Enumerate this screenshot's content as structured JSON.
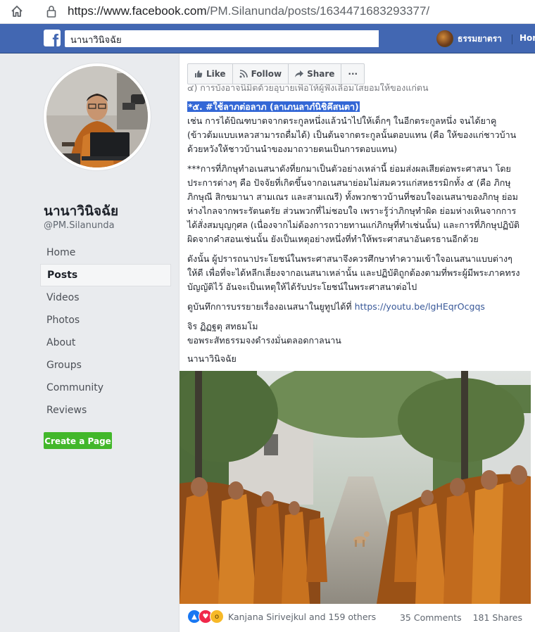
{
  "browser": {
    "url_host": "https://www.facebook.com",
    "url_path": "/PM.Silanunda/posts/1634471683293377/"
  },
  "topbar": {
    "search_value": "นานาวินิจฉัย",
    "user_name": "ธรรมยาตรา",
    "home_label": "Hon",
    "colors": {
      "bar": "#4267b2"
    }
  },
  "page": {
    "name": "นานาวินิจฉัย",
    "handle": "@PM.Silanunda",
    "nav": [
      "Home",
      "Posts",
      "Videos",
      "Photos",
      "About",
      "Groups",
      "Community",
      "Reviews"
    ],
    "active_nav": "Posts",
    "create_page_label": "Create a Page"
  },
  "actions": {
    "like": "Like",
    "follow": "Follow",
    "share": "Share",
    "more": "···"
  },
  "post": {
    "cut_line": "๔) การบังอาจนิมิตด้วยอุบายเพื่อให้ผู้ฟังเลื่อมใสยอมให้ของแก่ตน",
    "heading": "*๕. #ใช้ลาภต่อลาภ (ลาเภนลาภํนิชิคึสนตา)",
    "p1": "เช่น การได้บิณฑบาตจากตระกูลหนึ่งแล้วนำไปให้เด็กๆ ในอีกตระกูลหนึ่ง จนได้ยาคู (ข้าวต้มแบบเหลวสามารถดื่มได้) เป็นต้นจากตระกูลนั้นตอบแทน (คือ ให้ของแก่ชาวบ้านด้วยหวังให้ชาวบ้านนำของมาถวายตนเป็นการตอบแทน)",
    "p2": "***การที่ภิกษุทำอเนสนาดังที่ยกมาเป็นตัวอย่างเหล่านี้ ย่อมส่งผลเสียต่อพระศาสนา โดยประการต่างๆ คือ ปัจจัยที่เกิดขึ้นจากอเนสนาย่อมไม่สมควรแก่สหธรรมิกทั้ง ๕ (คือ ภิกษุ ภิกษุณี สิกขมานา สามเณร และสามเณรี) ทั้งพวกชาวบ้านที่ชอบใจอเนสนาของภิกษุ ย่อมห่างไกลจากพระรัตนตรัย ส่วนพวกที่ไม่ชอบใจ เพราะรู้ว่าภิกษุทำผิด ย่อมห่างเหินจากการได้สั่งสมบุญกุศล (เนื่องจากไม่ต้องการถวายทานแก่ภิกษุที่ทำเช่นนั้น) และการที่ภิกษุปฏิบัติผิดจากคำสอนเช่นนั้น ยังเป็นเหตุอย่างหนึ่งที่ทำให้พระศาสนาอันตรธานอีกด้วย",
    "p3": "ดังนั้น ผู้ปรารถนาประโยชน์ในพระศาสนาจึงควรศึกษาทำความเข้าใจอเนสนาแบบต่างๆ ให้ดี เพื่อที่จะได้หลีกเลี่ยงจากอเนสนาเหล่านั้น และปฏิบัติถูกต้องตามที่พระผู้มีพระภาคทรงบัญญัติไว้ อันจะเป็นเหตุให้ได้รับประโยชน์ในพระศาสนาต่อไป",
    "p4_prefix": "ดูบันทึกการบรรยายเรื่องอเนสนาในยูทูปได้ที่ ",
    "p4_link": "https://youtu.be/lgHEqrOcgqs",
    "sign1": "จิร ฏิฏฐตุ สทธมโม",
    "sign2": "ขอพระสัทธรรมจงดำรงมั่นตลอดกาลนาน",
    "sign3": "นานาวินิจฉัย"
  },
  "footer": {
    "reactors": "Kanjana Sirivejkul and 159 others",
    "comments": "35 Comments",
    "shares": "181 Shares",
    "reaction_icons": [
      "like-icon",
      "love-icon",
      "wow-icon"
    ]
  }
}
